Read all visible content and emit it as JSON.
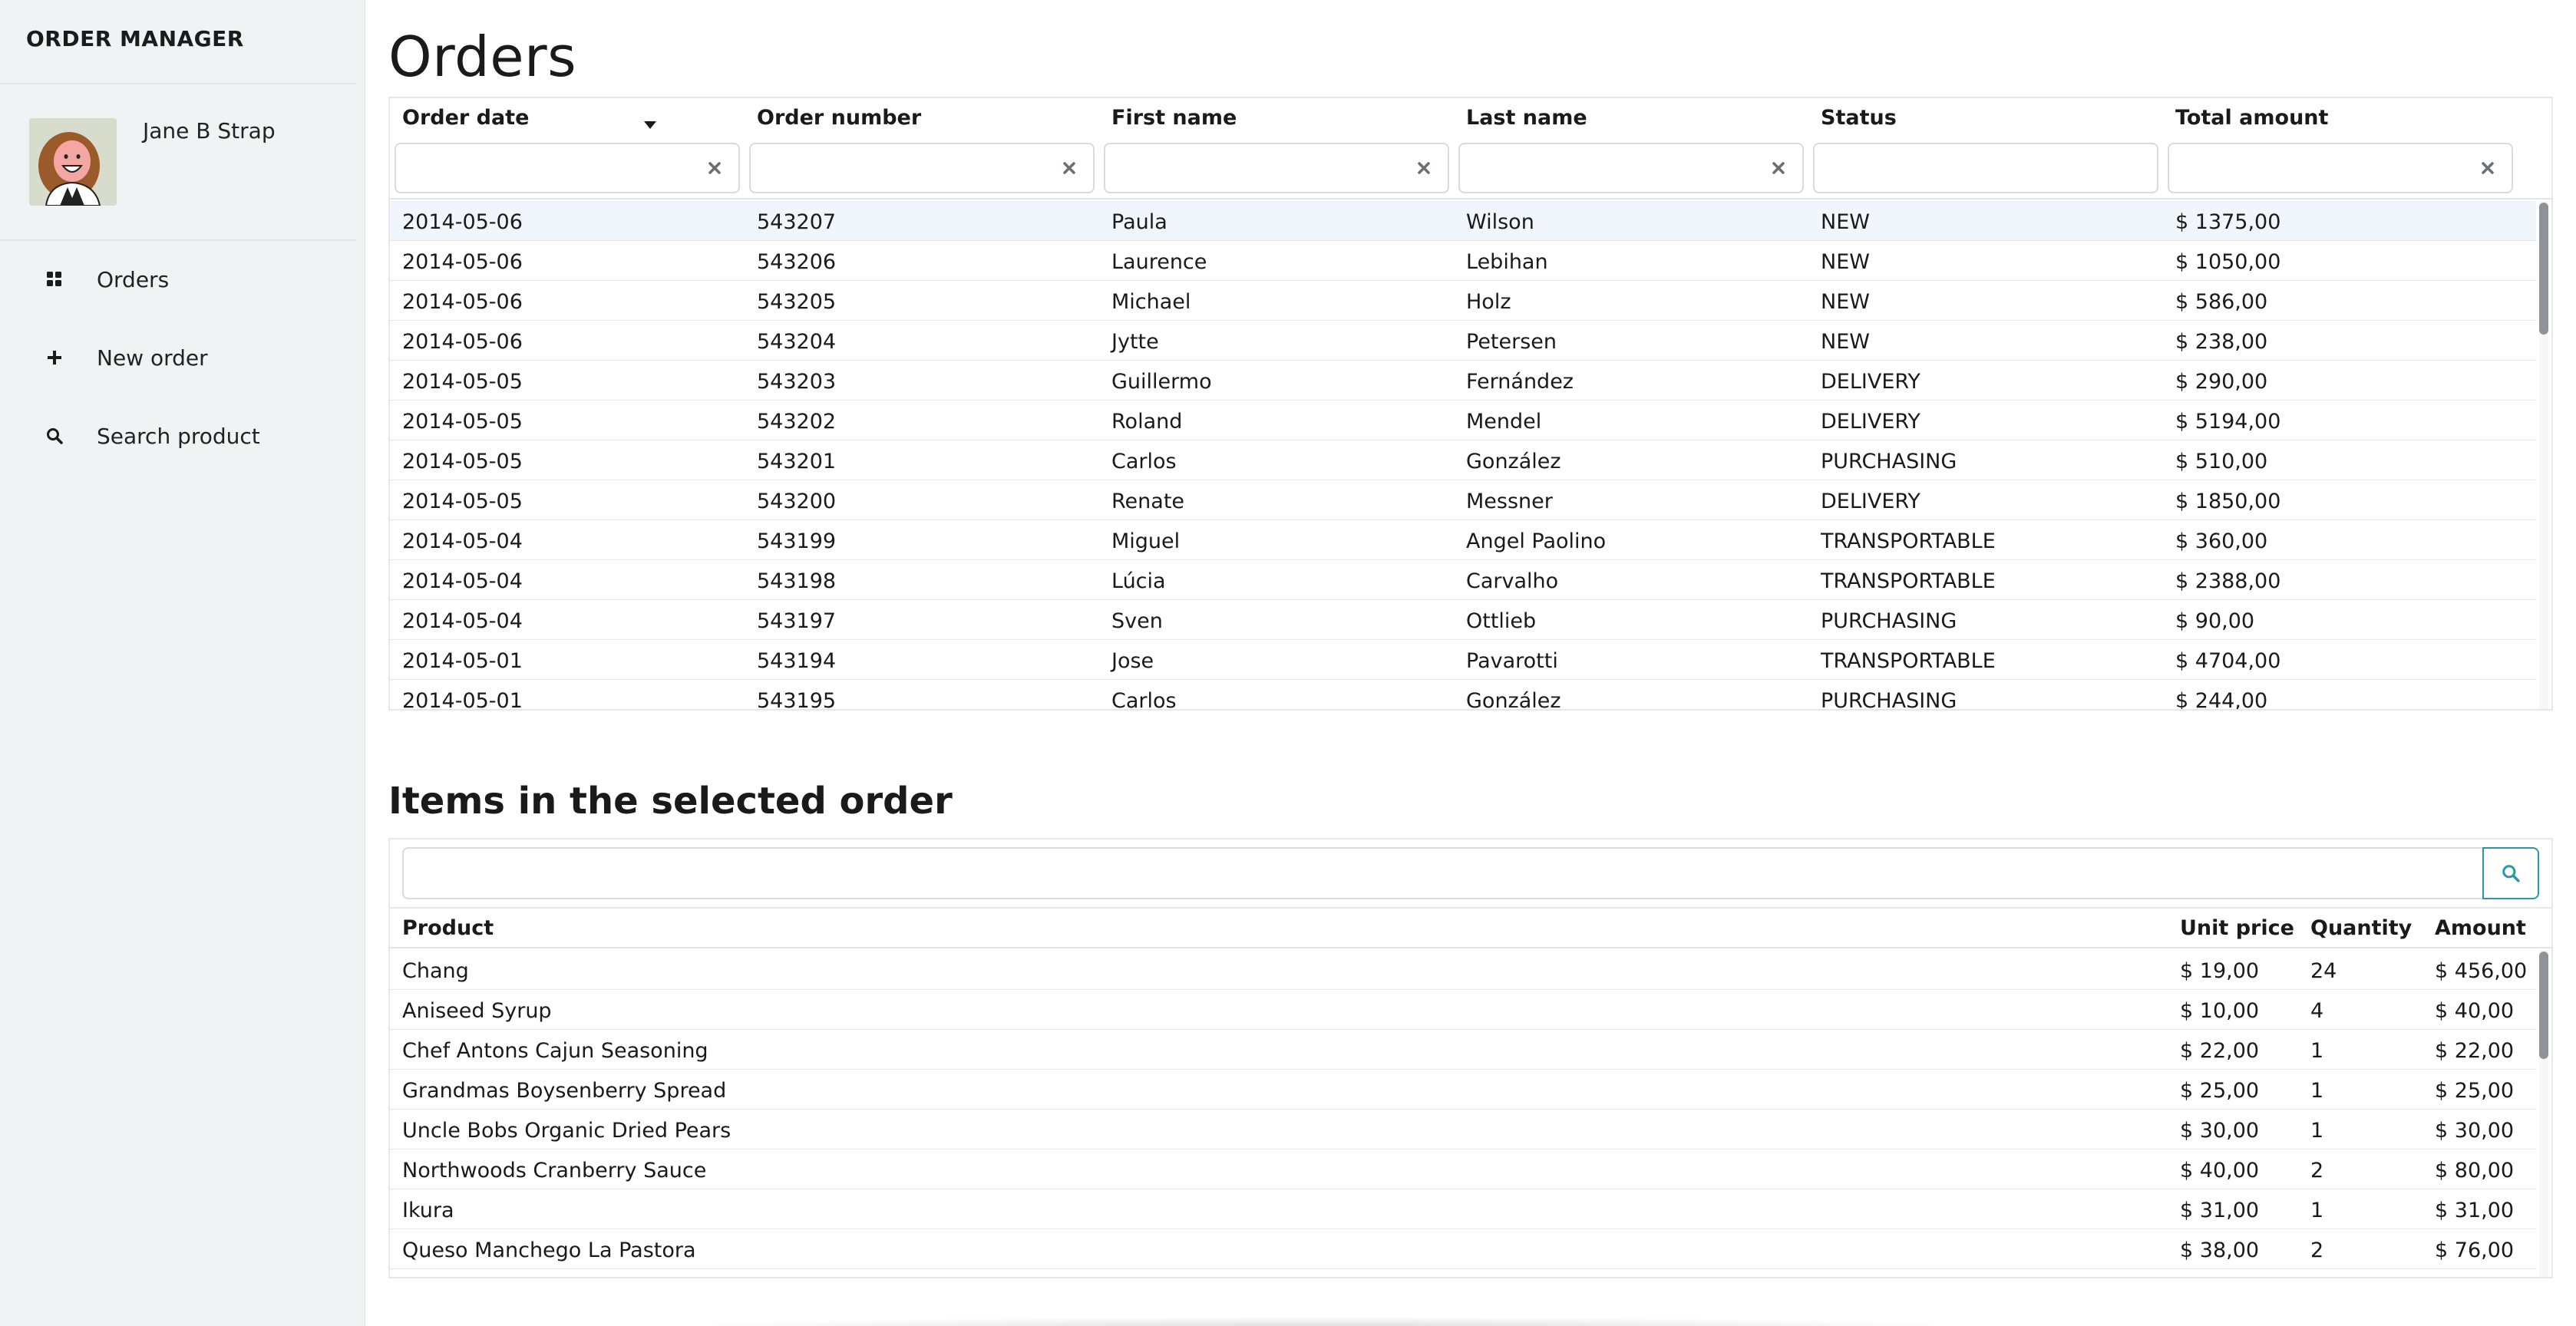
{
  "app": {
    "title": "ORDER MANAGER"
  },
  "user": {
    "name": "Jane B Strap"
  },
  "nav": [
    {
      "label": "Orders",
      "icon": "grid-icon"
    },
    {
      "label": "New order",
      "icon": "plus-icon"
    },
    {
      "label": "Search product",
      "icon": "search-icon"
    }
  ],
  "orders": {
    "title": "Orders",
    "columns": [
      "Order date",
      "Order number",
      "First name",
      "Last name",
      "Status",
      "Total amount"
    ],
    "sort": {
      "column": "Order date",
      "direction": "descending"
    },
    "rows": [
      [
        "2014-05-06",
        "543207",
        "Paula",
        "Wilson",
        "NEW",
        "$ 1375,00"
      ],
      [
        "2014-05-06",
        "543206",
        "Laurence",
        "Lebihan",
        "NEW",
        "$ 1050,00"
      ],
      [
        "2014-05-06",
        "543205",
        "Michael",
        "Holz",
        "NEW",
        "$ 586,00"
      ],
      [
        "2014-05-06",
        "543204",
        "Jytte",
        "Petersen",
        "NEW",
        "$ 238,00"
      ],
      [
        "2014-05-05",
        "543203",
        "Guillermo",
        "Fernández",
        "DELIVERY",
        "$ 290,00"
      ],
      [
        "2014-05-05",
        "543202",
        "Roland",
        "Mendel",
        "DELIVERY",
        "$ 5194,00"
      ],
      [
        "2014-05-05",
        "543201",
        "Carlos",
        "González",
        "PURCHASING",
        "$ 510,00"
      ],
      [
        "2014-05-05",
        "543200",
        "Renate",
        "Messner",
        "DELIVERY",
        "$ 1850,00"
      ],
      [
        "2014-05-04",
        "543199",
        "Miguel",
        "Angel Paolino",
        "TRANSPORTABLE",
        "$ 360,00"
      ],
      [
        "2014-05-04",
        "543198",
        "Lúcia",
        "Carvalho",
        "TRANSPORTABLE",
        "$ 2388,00"
      ],
      [
        "2014-05-04",
        "543197",
        "Sven",
        "Ottlieb",
        "PURCHASING",
        "$ 90,00"
      ],
      [
        "2014-05-01",
        "543194",
        "Jose",
        "Pavarotti",
        "TRANSPORTABLE",
        "$ 4704,00"
      ],
      [
        "2014-05-01",
        "543195",
        "Carlos",
        "González",
        "PURCHASING",
        "$ 244,00"
      ]
    ],
    "selected_row": 0
  },
  "items": {
    "title": "Items in the selected order",
    "search_value": "",
    "columns": [
      "Product",
      "Unit price",
      "Quantity",
      "Amount"
    ],
    "rows": [
      [
        "Chang",
        "$ 19,00",
        "24",
        "$ 456,00"
      ],
      [
        "Aniseed Syrup",
        "$ 10,00",
        "4",
        "$ 40,00"
      ],
      [
        "Chef Antons Cajun Seasoning",
        "$ 22,00",
        "1",
        "$ 22,00"
      ],
      [
        "Grandmas Boysenberry Spread",
        "$ 25,00",
        "1",
        "$ 25,00"
      ],
      [
        "Uncle Bobs Organic Dried Pears",
        "$ 30,00",
        "1",
        "$ 30,00"
      ],
      [
        "Northwoods Cranberry Sauce",
        "$ 40,00",
        "2",
        "$ 80,00"
      ],
      [
        "Ikura",
        "$ 31,00",
        "1",
        "$ 31,00"
      ],
      [
        "Queso Manchego La Pastora",
        "$ 38,00",
        "2",
        "$ 76,00"
      ]
    ]
  },
  "colors": {
    "accent": "#2e97a6",
    "selected_row": "#f0f6fc",
    "sidebar": "#f1f2f3"
  }
}
